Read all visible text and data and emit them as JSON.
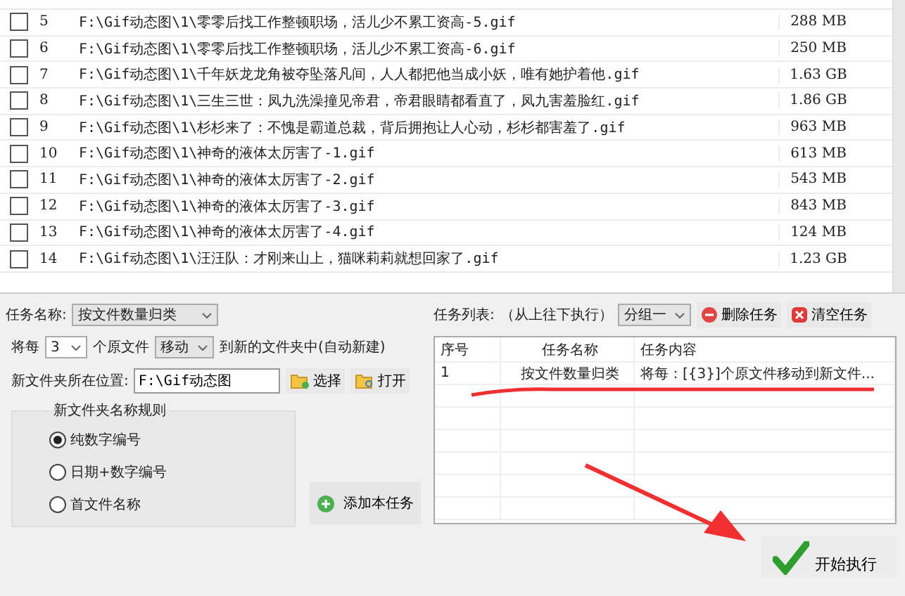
{
  "files": {
    "rows": [
      {
        "checked": false,
        "index": "5",
        "path": "F:\\Gif动态图\\1\\零零后找工作整顿职场，活儿少不累工资高-5.gif",
        "size": "288 MB"
      },
      {
        "checked": false,
        "index": "6",
        "path": "F:\\Gif动态图\\1\\零零后找工作整顿职场，活儿少不累工资高-6.gif",
        "size": "250 MB"
      },
      {
        "checked": false,
        "index": "7",
        "path": "F:\\Gif动态图\\1\\千年妖龙龙角被夺坠落凡间，人人都把他当成小妖，唯有她护着他.gif",
        "size": "1.63 GB"
      },
      {
        "checked": false,
        "index": "8",
        "path": "F:\\Gif动态图\\1\\三生三世：凤九洗澡撞见帝君，帝君眼睛都看直了，凤九害羞脸红.gif",
        "size": "1.86 GB"
      },
      {
        "checked": false,
        "index": "9",
        "path": "F:\\Gif动态图\\1\\杉杉来了：不愧是霸道总裁，背后拥抱让人心动，杉杉都害羞了.gif",
        "size": "963 MB"
      },
      {
        "checked": false,
        "index": "10",
        "path": "F:\\Gif动态图\\1\\神奇的液体太厉害了-1.gif",
        "size": "613 MB"
      },
      {
        "checked": false,
        "index": "11",
        "path": "F:\\Gif动态图\\1\\神奇的液体太厉害了-2.gif",
        "size": "543 MB"
      },
      {
        "checked": false,
        "index": "12",
        "path": "F:\\Gif动态图\\1\\神奇的液体太厉害了-3.gif",
        "size": "843 MB"
      },
      {
        "checked": false,
        "index": "13",
        "path": "F:\\Gif动态图\\1\\神奇的液体太厉害了-4.gif",
        "size": "124 MB"
      },
      {
        "checked": false,
        "index": "14",
        "path": "F:\\Gif动态图\\1\\汪汪队：才刚来山上，猫咪莉莉就想回家了.gif",
        "size": "1.23 GB"
      }
    ]
  },
  "task_form": {
    "name_label": "任务名称:",
    "name_value": "按文件数量归类",
    "per_label": "将每",
    "count": "3",
    "unit_label": "个原文件",
    "action": "移动",
    "tail": "到新的文件夹中(自动新建)",
    "location_label": "新文件夹所在位置:",
    "location_value": "F:\\Gif动态图",
    "select_button": "选择",
    "open_button": "打开",
    "rule_group": {
      "title": "新文件夹名称规则",
      "options": [
        {
          "label": "纯数字编号",
          "selected": true
        },
        {
          "label": "日期+数字编号",
          "selected": false
        },
        {
          "label": "首文件名称",
          "selected": false
        }
      ]
    },
    "add_button": "添加本任务"
  },
  "task_list": {
    "label": "任务列表:",
    "hint": "（从上往下执行）",
    "group": "分组一",
    "delete_button": "删除任务",
    "clear_button": "清空任务",
    "columns": [
      "序号",
      "任务名称",
      "任务内容"
    ],
    "rows": [
      {
        "index": "1",
        "name": "按文件数量归类",
        "content": "将每：[{3}]个原文件移动到新文件..."
      }
    ],
    "start_button": "开始执行"
  }
}
